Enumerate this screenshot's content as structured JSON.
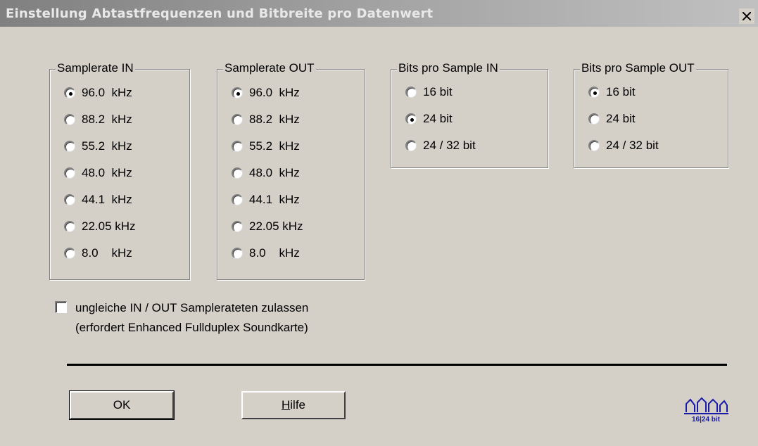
{
  "window": {
    "title": "Einstellung Abtastfrequenzen  und  Bitbreite pro Datenwert",
    "close_icon": "close-icon"
  },
  "groups": {
    "samplerate_in": {
      "title": "Samplerate IN",
      "options": [
        "96.0  kHz",
        "88.2  kHz",
        "55.2  kHz",
        "48.0  kHz",
        "44.1  kHz",
        "22.05 kHz",
        "8.0    kHz"
      ],
      "selected": "96.0  kHz"
    },
    "samplerate_out": {
      "title": "Samplerate OUT",
      "options": [
        "96.0  kHz",
        "88.2  kHz",
        "55.2  kHz",
        "48.0  kHz",
        "44.1  kHz",
        "22.05 kHz",
        "8.0    kHz"
      ],
      "selected": "96.0  kHz"
    },
    "bits_in": {
      "title": "Bits pro Sample  IN",
      "options": [
        "16 bit",
        "24 bit",
        "24 / 32 bit"
      ],
      "selected": "24 bit"
    },
    "bits_out": {
      "title": "Bits pro Sample OUT",
      "options": [
        "16 bit",
        "24 bit",
        "24 / 32 bit"
      ],
      "selected": "16 bit"
    }
  },
  "checkbox": {
    "line1": "ungleiche  IN / OUT Samplerateten zulassen",
    "line2": "(erfordert  Enhanced Fullduplex Soundkarte)",
    "checked": false
  },
  "buttons": {
    "ok": "OK",
    "help_rest": "ilfe",
    "help_mnemonic": "H"
  },
  "logo": {
    "text": "16|24 bit",
    "color": "#1a1aa8"
  }
}
